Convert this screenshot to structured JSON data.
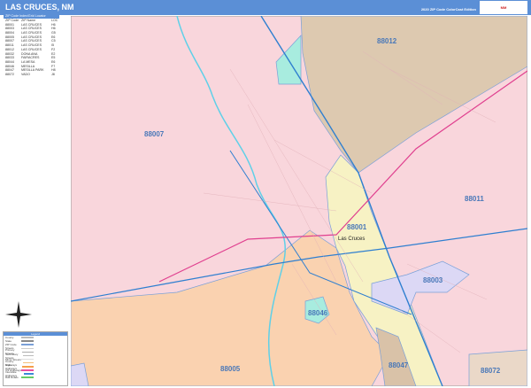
{
  "header": {
    "title": "LAS CRUCES, NM",
    "edition": "2020 ZIP Code ColorCast Edition",
    "logo": "Market MAPS"
  },
  "index": {
    "title": "ZIP Code Index/Grid Locator",
    "columns": [
      "ZIP Code",
      "ZIP Name",
      "LOC"
    ],
    "rows": [
      [
        "88001",
        "LAS CRUCES",
        "H6"
      ],
      [
        "88003",
        "LAS CRUCES",
        "H6"
      ],
      [
        "88004",
        "LAS CRUCES",
        "G5"
      ],
      [
        "88005",
        "LAS CRUCES",
        "E6"
      ],
      [
        "88007",
        "LAS CRUCES",
        "C5"
      ],
      [
        "88011",
        "LAS CRUCES",
        "I5"
      ],
      [
        "88012",
        "LAS CRUCES",
        "F2"
      ],
      [
        "88032",
        "DONA ANA",
        "E2"
      ],
      [
        "88033",
        "FAIRACRES",
        "E5"
      ],
      [
        "88044",
        "LA MESA",
        "E6"
      ],
      [
        "88046",
        "MESILLA",
        "F7"
      ],
      [
        "88047",
        "MESILLA PARK",
        "H8"
      ],
      [
        "88072",
        "VADO",
        "J8"
      ]
    ]
  },
  "legend": {
    "title": "Legend",
    "items": [
      {
        "label": "County",
        "color": "#bbbbbb"
      },
      {
        "label": "State",
        "color": "#888888"
      },
      {
        "label": "ZIP Code",
        "color": "#7aa0d8"
      },
      {
        "label": "Streets",
        "color": "#cccccc"
      },
      {
        "label": "Primary Streets",
        "color": "#aaaaaa"
      },
      {
        "label": "Secondary Streets",
        "color": "#bbbbbb"
      },
      {
        "label": "Minor Streets",
        "color": "#dddddd"
      },
      {
        "label": "County Highways",
        "color": "#f5c07a"
      },
      {
        "label": "State Highways",
        "color": "#f5a04a"
      },
      {
        "label": "US Highways",
        "color": "#e84fa0"
      },
      {
        "label": "Interstate Highways",
        "color": "#3c8ad8"
      },
      {
        "label": "Rail Roads",
        "color": "#66cc66"
      }
    ]
  },
  "map": {
    "zips": [
      "88012",
      "88007",
      "88011",
      "88001",
      "88003",
      "88046",
      "88005",
      "88047",
      "88072"
    ],
    "city": "Las Cruces",
    "colors": {
      "pink": "#f9d6dc",
      "tan": "#ddc9b0",
      "yellow": "#f7f2c4",
      "orange": "#fad2b0",
      "lavender": "#dcd8f5",
      "teal": "#a8ecdf",
      "brown": "#d9c2a8",
      "interstate": "#2f7fd0",
      "us_highway": "#e0408f",
      "river": "#5fd0e8"
    }
  }
}
